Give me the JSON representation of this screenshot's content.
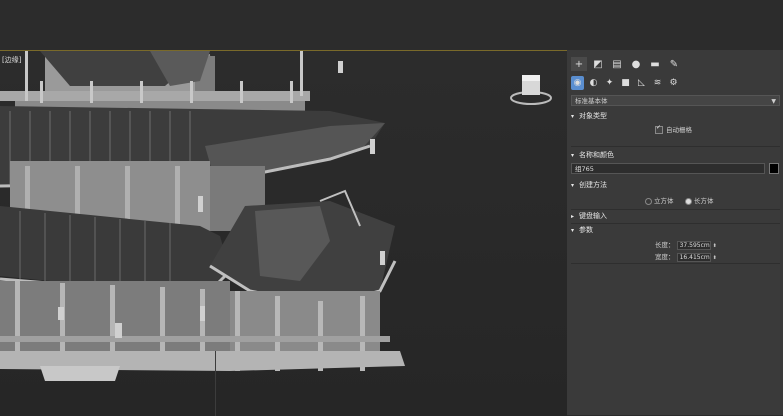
{
  "viewport": {
    "label": "[边缘]"
  },
  "panel": {
    "tabs": [
      {
        "name": "create",
        "glyph": "+"
      },
      {
        "name": "modify",
        "glyph": "◩"
      },
      {
        "name": "hierarchy",
        "glyph": "▤"
      },
      {
        "name": "motion",
        "glyph": "●"
      },
      {
        "name": "display",
        "glyph": "▬"
      },
      {
        "name": "utilities",
        "glyph": "✎"
      }
    ],
    "subtabs": [
      {
        "name": "geometry",
        "glyph": "◉"
      },
      {
        "name": "shapes",
        "glyph": "◐"
      },
      {
        "name": "lights",
        "glyph": "✦"
      },
      {
        "name": "cameras",
        "glyph": "■"
      },
      {
        "name": "helpers",
        "glyph": "◺"
      },
      {
        "name": "spacewarps",
        "glyph": "≋"
      },
      {
        "name": "systems",
        "glyph": "⚙"
      }
    ],
    "category": "标准基本体",
    "object_type": {
      "title": "对象类型",
      "autogrid_label": "自动栅格",
      "autogrid_checked": true
    },
    "name_color": {
      "title": "名称和颜色",
      "name_value": "组765",
      "color": "#000000"
    },
    "creation_method": {
      "title": "创建方法",
      "option_cube": "立方体",
      "option_box": "长方体",
      "selected": "box"
    },
    "keyboard_entry": {
      "title": "键盘输入"
    },
    "parameters": {
      "title": "参数",
      "length_label": "长度：",
      "length_value": "37.595cm",
      "width_label": "宽度：",
      "width_value": "16.415cm"
    }
  }
}
